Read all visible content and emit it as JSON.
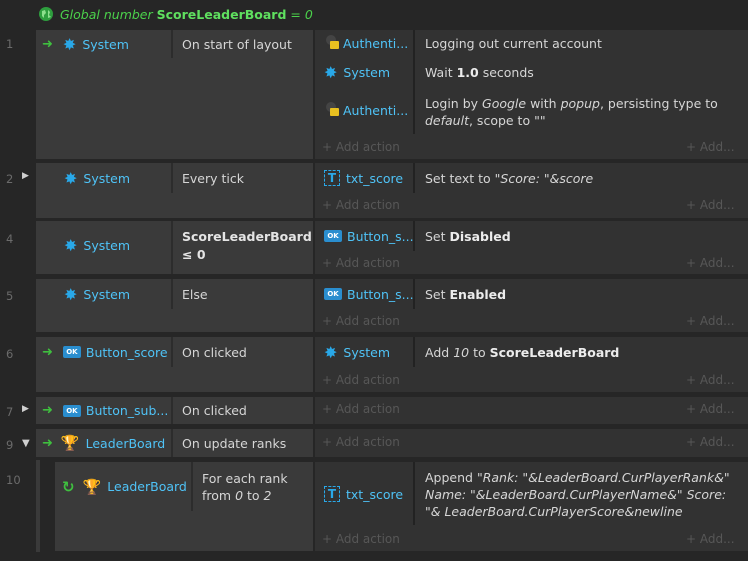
{
  "global_var": {
    "prefix": "Global number",
    "name": "ScoreLeaderBoard",
    "suffix": "= 0"
  },
  "add_action": "+ Add action",
  "add_more": "+ Add...",
  "events": [
    {
      "number": "1",
      "obj": "System",
      "trigger": "On start of layout",
      "actions": [
        {
          "obj": "Authenti...",
          "parts": [
            {
              "t": "Logging out current account"
            }
          ]
        },
        {
          "obj": "System",
          "parts": [
            {
              "t": "Wait "
            },
            {
              "t": "1.0",
              "s": "b"
            },
            {
              "t": " seconds"
            }
          ]
        },
        {
          "obj": "Authenti...",
          "parts": [
            {
              "t": "Login by "
            },
            {
              "t": "Google",
              "s": "i"
            },
            {
              "t": " with "
            },
            {
              "t": "popup",
              "s": "i"
            },
            {
              "t": ", persisting type to "
            },
            {
              "t": "default",
              "s": "i"
            },
            {
              "t": ", scope to \"\""
            }
          ]
        }
      ]
    },
    {
      "number": "2",
      "obj": "System",
      "trigger": "Every tick",
      "actions": [
        {
          "obj": "txt_score",
          "parts": [
            {
              "t": "Set text to "
            },
            {
              "t": "\"Score: \"&score",
              "s": "i"
            }
          ]
        }
      ]
    },
    {
      "number": "4",
      "obj": "System",
      "trigger": "ScoreLeaderBoard ≤ 0",
      "actions": [
        {
          "obj": "Button_s...",
          "parts": [
            {
              "t": "Set "
            },
            {
              "t": "Disabled",
              "s": "b"
            }
          ]
        }
      ]
    },
    {
      "number": "5",
      "obj": "System",
      "trigger": "Else",
      "actions": [
        {
          "obj": "Button_s...",
          "parts": [
            {
              "t": "Set "
            },
            {
              "t": "Enabled",
              "s": "b"
            }
          ]
        }
      ]
    },
    {
      "number": "6",
      "obj": "Button_score",
      "trigger": "On clicked",
      "actions": [
        {
          "obj": "System",
          "parts": [
            {
              "t": "Add "
            },
            {
              "t": "10",
              "s": "i"
            },
            {
              "t": " to "
            },
            {
              "t": "ScoreLeaderBoard",
              "s": "b"
            }
          ]
        }
      ]
    },
    {
      "number": "7",
      "obj": "Button_sub...",
      "trigger": "On clicked",
      "actions": []
    },
    {
      "number": "9",
      "obj": "LeaderBoard",
      "trigger": "On update ranks",
      "actions": []
    },
    {
      "number": "10",
      "obj": "LeaderBoard",
      "trigger_parts": [
        {
          "t": "For each rank from "
        },
        {
          "t": "0",
          "s": "i"
        },
        {
          "t": " to "
        },
        {
          "t": "2",
          "s": "i"
        }
      ],
      "actions": [
        {
          "obj": "txt_score",
          "parts": [
            {
              "t": "Append "
            },
            {
              "t": "\"Rank: \"&LeaderBoard.CurPlayerRank&\" Name: \"&LeaderBoard.CurPlayerName&\" Score: \"& LeaderBoard.CurPlayerScore&newline",
              "s": "i"
            }
          ]
        }
      ]
    }
  ],
  "icons": {
    "globe": "globe-icon",
    "system": "gear-icon",
    "auth": "authentication-lock-icon",
    "text": "text-object-icon",
    "button": "button-object-icon",
    "leaderboard": "trophy-icon",
    "loop": "loop-icon",
    "trigger": "trigger-arrow-icon",
    "expand": "expand-triangle-icon"
  }
}
